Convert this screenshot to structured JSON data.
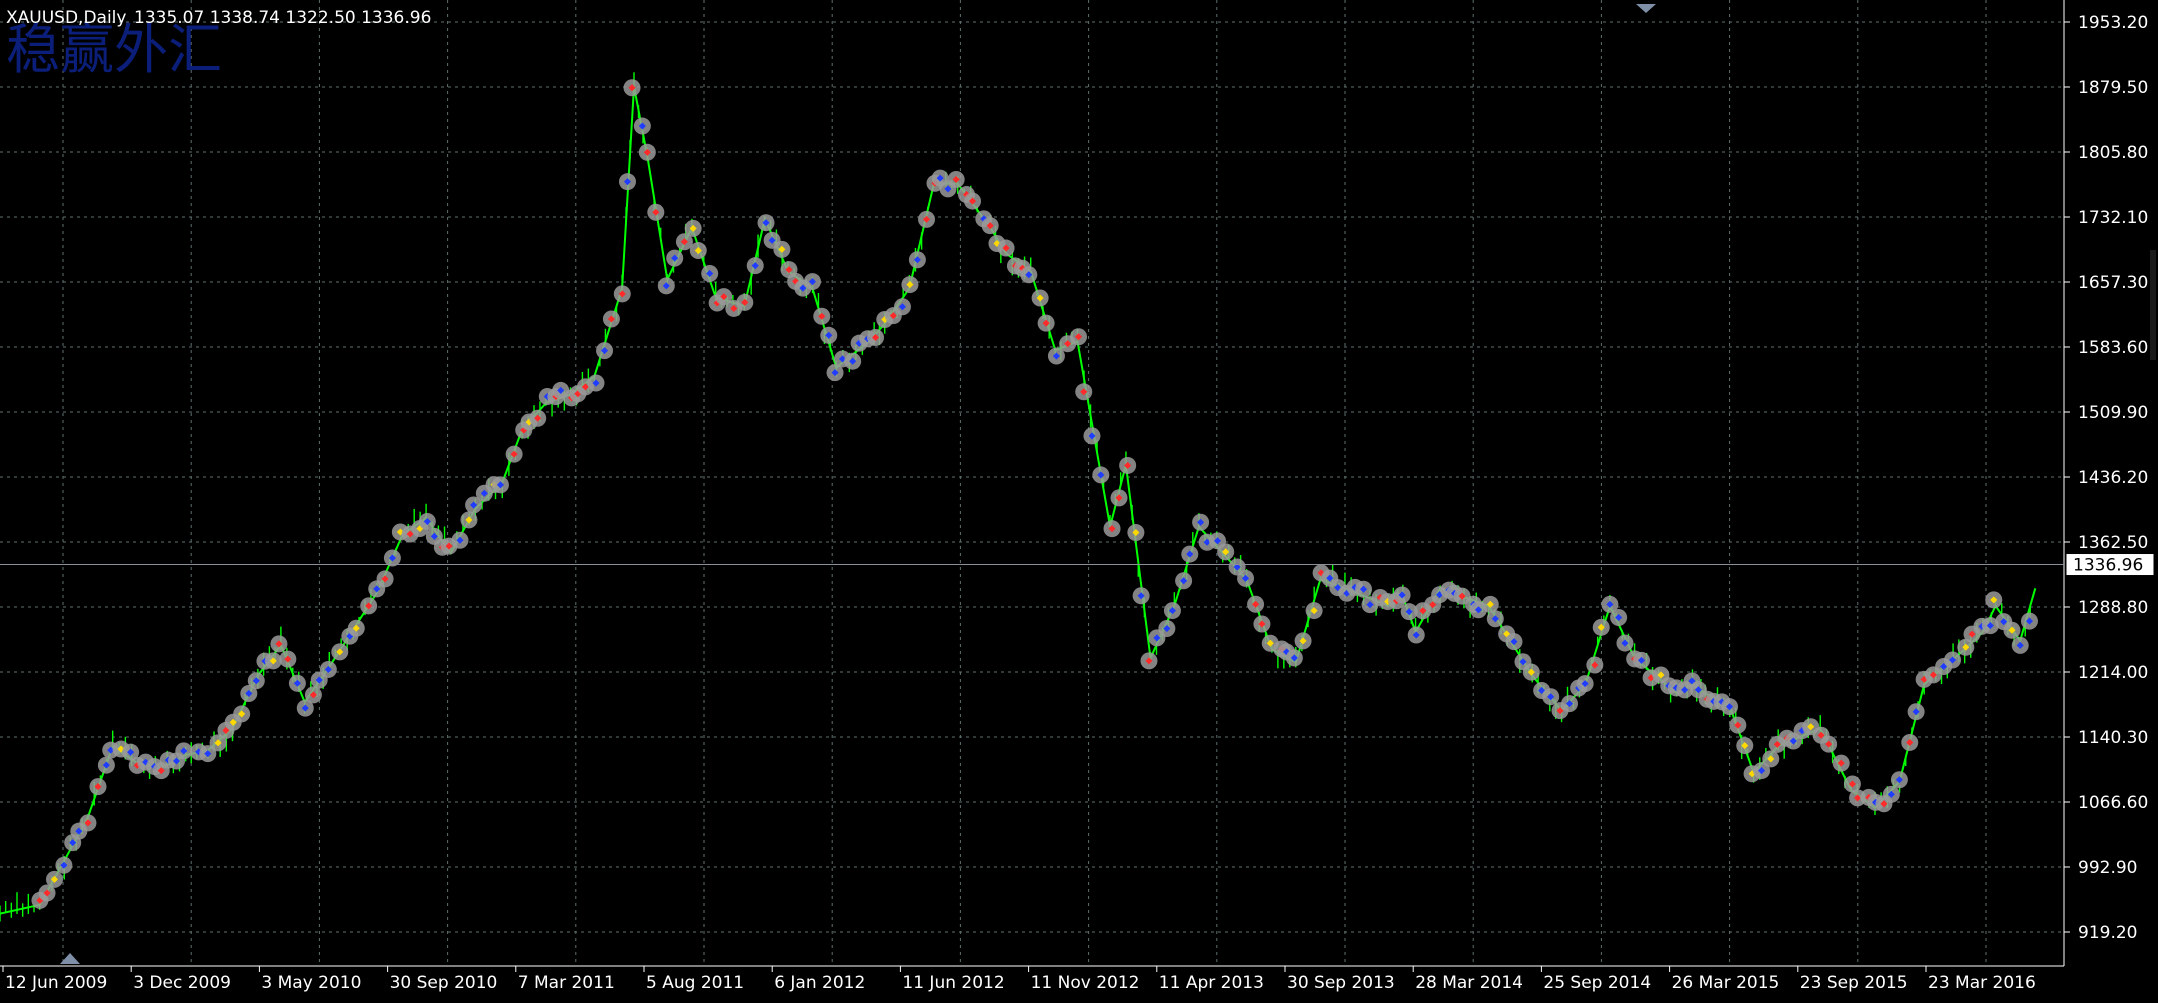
{
  "header": {
    "symbol": "XAUUSD,Daily",
    "ohlc": "1335.07 1338.74 1322.50 1336.96"
  },
  "watermark": "稳赢外汇",
  "current_price_label": "1336.96",
  "colors": {
    "background": "#000000",
    "grid": "#5f6f6f",
    "candle": "#00ff00",
    "axis_text": "#ffffff",
    "marker_halo": "#9a9a9a",
    "marker_blue": "#1f3cff",
    "marker_red": "#ff2a2a",
    "marker_yellow": "#ffd800",
    "price_line": "#8a8f99"
  },
  "chart_data": {
    "type": "line",
    "title": "XAUUSD,Daily",
    "y_ticks": [
      "1953.20",
      "1879.50",
      "1805.80",
      "1732.10",
      "1657.30",
      "1583.60",
      "1509.90",
      "1436.20",
      "1362.50",
      "1288.80",
      "1214.00",
      "1140.30",
      "1066.60",
      "992.90",
      "919.20"
    ],
    "x_ticks": [
      "12 Jun 2009",
      "3 Dec 2009",
      "3 May 2010",
      "30 Sep 2010",
      "7 Mar 2011",
      "5 Aug 2011",
      "6 Jan 2012",
      "11 Jun 2012",
      "11 Nov 2012",
      "11 Apr 2013",
      "30 Sep 2013",
      "28 Mar 2014",
      "25 Sep 2014",
      "26 Mar 2015",
      "23 Sep 2015",
      "23 Mar 2016"
    ],
    "ylim": [
      900,
      1960
    ],
    "x_range": [
      "2009-06-12",
      "2016-07-01"
    ],
    "current_price": 1336.96,
    "grid": true,
    "series": [
      {
        "x": [
          "2009-06-12",
          "2009-08-01",
          "2009-09-01",
          "2009-10-01",
          "2009-11-01",
          "2009-12-03",
          "2010-01-01",
          "2010-02-01",
          "2010-03-01",
          "2010-04-01",
          "2010-05-03",
          "2010-06-01",
          "2010-07-01",
          "2010-08-01",
          "2010-09-30",
          "2010-11-01",
          "2010-12-01",
          "2011-01-01",
          "2011-02-01",
          "2011-03-07",
          "2011-04-01",
          "2011-05-01",
          "2011-06-01",
          "2011-07-01",
          "2011-08-05",
          "2011-08-20",
          "2011-09-06",
          "2011-10-01",
          "2011-11-01",
          "2011-12-01",
          "2012-01-06",
          "2012-02-01",
          "2012-03-01",
          "2012-04-01",
          "2012-05-01",
          "2012-06-11",
          "2012-07-01",
          "2012-08-01",
          "2012-09-01",
          "2012-10-01",
          "2012-11-11",
          "2012-12-01",
          "2013-01-01",
          "2013-02-01",
          "2013-03-01",
          "2013-04-11",
          "2013-05-01",
          "2013-06-01",
          "2013-07-01",
          "2013-08-01",
          "2013-09-30",
          "2013-11-01",
          "2013-12-01",
          "2014-01-01",
          "2014-02-01",
          "2014-03-28",
          "2014-04-15",
          "2014-05-01",
          "2014-06-01",
          "2014-07-01",
          "2014-08-01",
          "2014-09-25",
          "2014-11-01",
          "2014-12-01",
          "2015-01-01",
          "2015-02-01",
          "2015-03-26",
          "2015-04-15",
          "2015-05-01",
          "2015-06-01",
          "2015-07-01",
          "2015-08-01",
          "2015-09-23",
          "2015-11-01",
          "2015-12-01",
          "2016-01-01",
          "2016-02-01",
          "2016-03-23",
          "2016-04-15",
          "2016-05-01",
          "2016-06-01",
          "2016-06-20"
        ],
        "y": [
          940,
          950,
          1000,
          1050,
          1130,
          1110,
          1105,
          1120,
          1125,
          1150,
          1210,
          1245,
          1180,
          1220,
          1305,
          1370,
          1390,
          1350,
          1400,
          1430,
          1490,
          1520,
          1530,
          1550,
          1650,
          1880,
          1800,
          1660,
          1720,
          1640,
          1630,
          1730,
          1670,
          1650,
          1560,
          1590,
          1610,
          1650,
          1770,
          1770,
          1720,
          1690,
          1670,
          1580,
          1590,
          1380,
          1450,
          1230,
          1290,
          1380,
          1320,
          1240,
          1225,
          1320,
          1310,
          1290,
          1300,
          1260,
          1310,
          1300,
          1290,
          1210,
          1170,
          1200,
          1290,
          1230,
          1190,
          1200,
          1190,
          1175,
          1100,
          1130,
          1150,
          1080,
          1060,
          1090,
          1200,
          1240,
          1260,
          1290,
          1250,
          1310
        ]
      }
    ]
  }
}
